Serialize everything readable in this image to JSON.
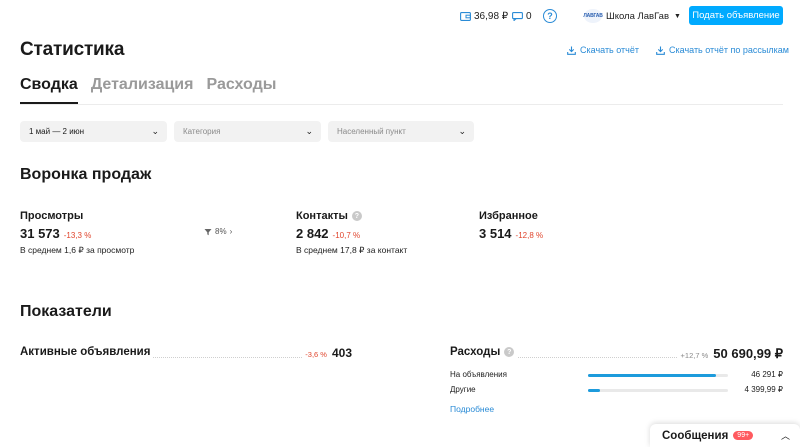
{
  "topbar": {
    "wallet_amount": "36,98 ₽",
    "messages_count": "0",
    "help_symbol": "?",
    "account_logo": "ЛАВГАВ",
    "account_name": "Школа ЛавГав",
    "post_button": "Подать объявление",
    "icons": [
      "wallet-icon",
      "message-icon",
      "help-icon",
      "chevron-down-icon"
    ]
  },
  "header": {
    "title": "Статистика",
    "download_report": "Скачать отчёт",
    "download_mailing_report": "Скачать отчёт по рассылкам"
  },
  "tabs": [
    {
      "label": "Сводка",
      "active": true
    },
    {
      "label": "Детализация",
      "active": false
    },
    {
      "label": "Расходы",
      "active": false
    }
  ],
  "filters": {
    "period": "1 май — 2 июн",
    "category_placeholder": "Категория",
    "city_placeholder": "Населенный пункт"
  },
  "funnel": {
    "title": "Воронка продаж",
    "views": {
      "label": "Просмотры",
      "value": "31 573",
      "delta": "-13,3 %",
      "sub": "В среднем 1,6 ₽ за просмотр"
    },
    "conversion": "8%",
    "contacts": {
      "label": "Контакты",
      "value": "2 842",
      "delta": "-10,7 %",
      "sub": "В среднем 17,8 ₽ за контакт"
    },
    "favorites": {
      "label": "Избранное",
      "value": "3 514",
      "delta": "-12,8 %"
    }
  },
  "indicators": {
    "title": "Показатели",
    "active_ads": {
      "label": "Активные объявления",
      "delta": "-3,6 %",
      "value": "403"
    },
    "spend": {
      "label": "Расходы",
      "delta": "+12,7 %",
      "value": "50 690,99 ₽",
      "items": [
        {
          "label": "На объявления",
          "value": "46 291 ₽",
          "share": 0.913
        },
        {
          "label": "Другие",
          "value": "4 399,99 ₽",
          "share": 0.087
        }
      ],
      "more": "Подробнее"
    }
  },
  "messages_panel": {
    "title": "Сообщения",
    "badge": "99+"
  },
  "colors": {
    "accent": "#00aaff",
    "link": "#2a8bd6",
    "negative": "#e0452d",
    "bar": "#1d9bdc"
  }
}
